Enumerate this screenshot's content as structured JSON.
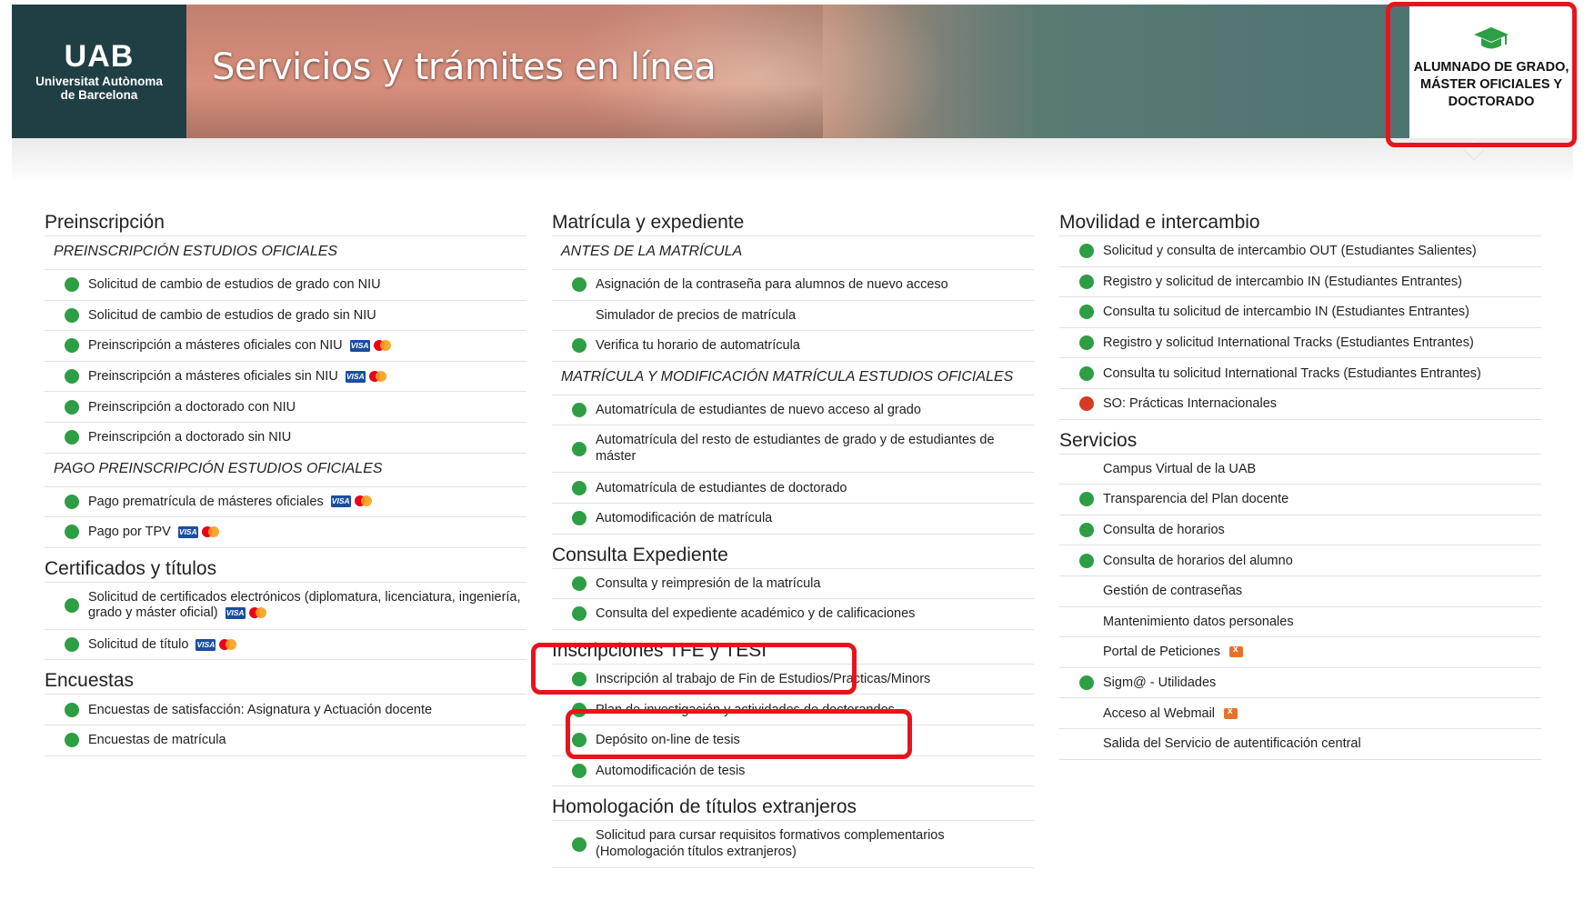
{
  "header": {
    "logo_title": "UAB",
    "logo_line1": "Universitat Autònoma",
    "logo_line2": "de Barcelona",
    "banner_title": "Servicios y trámites en línea",
    "profile_icon": "graduation-cap-icon",
    "profile_line1": "ALUMNADO DE GRADO,",
    "profile_line2": "MÁSTER OFICIALES Y",
    "profile_line3": "DOCTORADO"
  },
  "colors": {
    "status_green": "#2e9e44",
    "status_red": "#d63a22",
    "highlight_red": "#e8141b"
  },
  "col1": {
    "preinscripcion": {
      "title": "Preinscripción",
      "sub1": "PREINSCRIPCIÓN ESTUDIOS OFICIALES",
      "items1": [
        "Solicitud de cambio de estudios de grado con NIU",
        "Solicitud de cambio de estudios de grado sin NIU",
        "Preinscripción a másteres oficiales con NIU",
        "Preinscripción a másteres oficiales sin NIU",
        "Preinscripción a doctorado con NIU",
        "Preinscripción a doctorado sin NIU"
      ],
      "sub2": "PAGO PREINSCRIPCIÓN ESTUDIOS OFICIALES",
      "items2": [
        "Pago prematrícula de másteres oficiales",
        "Pago por TPV"
      ]
    },
    "certificados": {
      "title": "Certificados y títulos",
      "items": [
        "Solicitud de certificados electrónicos (diplomatura, licenciatura, ingeniería, grado y máster oficial)",
        "Solicitud de título"
      ]
    },
    "encuestas": {
      "title": "Encuestas",
      "items": [
        "Encuestas de satisfacción: Asignatura y Actuación docente",
        "Encuestas de matrícula"
      ]
    }
  },
  "col2": {
    "matricula": {
      "title": "Matrícula y expediente",
      "sub1": "ANTES DE LA MATRÍCULA",
      "items1": [
        "Asignación de la contraseña para alumnos de nuevo acceso",
        "Simulador de precios de matrícula",
        "Verifica tu horario de automatrícula"
      ],
      "sub2": "MATRÍCULA Y MODIFICACIÓN MATRÍCULA ESTUDIOS OFICIALES",
      "items2": [
        "Automatrícula de estudiantes de nuevo acceso al grado",
        "Automatrícula del resto de estudiantes de grado y de estudiantes de máster",
        "Automatrícula de estudiantes de doctorado",
        "Automodificación de matrícula"
      ]
    },
    "consulta": {
      "title": "Consulta Expediente",
      "items": [
        "Consulta y reimpresión de la matrícula",
        "Consulta del expediente académico y de calificaciones"
      ]
    },
    "inscripciones": {
      "title": "Inscripciones TFE y TESI",
      "items": [
        "Inscripción al trabajo de Fin de Estudios/Practicas/Minors",
        "Plan de investigación y actividades de doctorandos",
        "Depósito on-line de tesis",
        "Automodificación de tesis"
      ]
    },
    "homologacion": {
      "title": "Homologación de títulos extranjeros",
      "items": [
        "Solicitud para cursar requisitos formativos complementarios (Homologación títulos extranjeros)"
      ]
    }
  },
  "col3": {
    "movilidad": {
      "title": "Movilidad e intercambio",
      "items": [
        "Solicitud y consulta de intercambio OUT (Estudiantes Salientes)",
        "Registro y solicitud de intercambio IN (Estudiantes Entrantes)",
        "Consulta tu solicitud de intercambio IN (Estudiantes Entrantes)",
        "Registro y solicitud International Tracks (Estudiantes Entrantes)",
        "Consulta tu solicitud International Tracks (Estudiantes Entrantes)",
        "SO: Prácticas Internacionales"
      ]
    },
    "servicios": {
      "title": "Servicios",
      "items": [
        "Campus Virtual de la UAB",
        "Transparencia del Plan docente",
        "Consulta de horarios",
        "Consulta de horarios del alumno",
        "Gestión de contraseñas",
        "Mantenimiento datos personales",
        "Portal de Peticiones",
        "Sigm@ - Utilidades",
        "Acceso al Webmail",
        "Salida del Servicio de autentificación central"
      ]
    }
  }
}
